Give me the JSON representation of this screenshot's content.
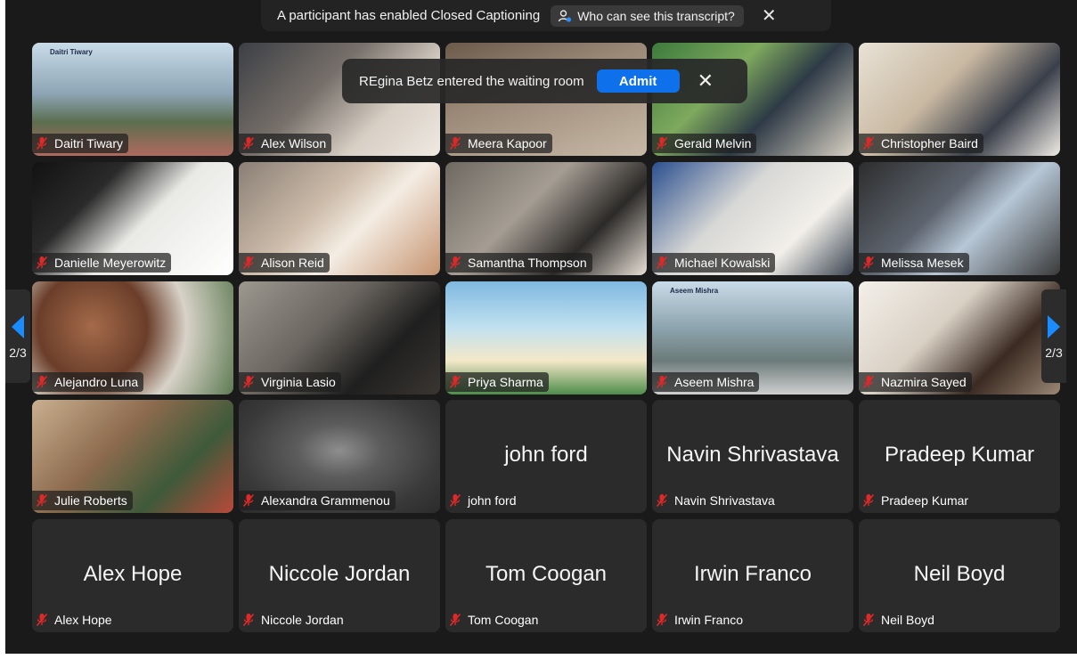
{
  "caption_banner": {
    "text": "A participant has enabled Closed Captioning",
    "transcript_button": "Who can see this transcript?"
  },
  "waiting_room": {
    "text": "REgina Betz entered the waiting room",
    "admit_label": "Admit"
  },
  "pager": {
    "left_page": "2/3",
    "right_page": "2/3"
  },
  "video_labels": {
    "daitri_banner": "Daitri Tiwary",
    "aseem_banner": "Aseem Mishra"
  },
  "participants": [
    {
      "name": "Daitri Tiwary",
      "video": true
    },
    {
      "name": "Alex Wilson",
      "video": true
    },
    {
      "name": "Meera Kapoor",
      "video": true
    },
    {
      "name": "Gerald Melvin",
      "video": true
    },
    {
      "name": "Christopher Baird",
      "video": true
    },
    {
      "name": "Danielle Meyerowitz",
      "video": true
    },
    {
      "name": "Alison Reid",
      "video": true
    },
    {
      "name": "Samantha Thompson",
      "video": true
    },
    {
      "name": "Michael Kowalski",
      "video": true
    },
    {
      "name": "Melissa Mesek",
      "video": true
    },
    {
      "name": "Alejandro Luna",
      "video": true
    },
    {
      "name": "Virginia Lasio",
      "video": true
    },
    {
      "name": "Priya Sharma",
      "video": true
    },
    {
      "name": "Aseem Mishra",
      "video": true
    },
    {
      "name": "Nazmira Sayed",
      "video": true
    },
    {
      "name": "Julie Roberts",
      "video": true
    },
    {
      "name": "Alexandra Grammenou",
      "video": true
    },
    {
      "name": "john ford",
      "video": false
    },
    {
      "name": "Navin Shrivastava",
      "video": false
    },
    {
      "name": "Pradeep Kumar",
      "video": false
    },
    {
      "name": "Alex Hope",
      "video": false
    },
    {
      "name": "Niccole Jordan",
      "video": false
    },
    {
      "name": "Tom Coogan",
      "video": false
    },
    {
      "name": "Irwin Franco",
      "video": false
    },
    {
      "name": "Neil Boyd",
      "video": false
    }
  ],
  "colors": {
    "admit": "#0e71eb",
    "muted_icon": "#e02828",
    "arrow": "#1a8cff"
  },
  "icons": {
    "mic": "muted-mic-icon",
    "transcript": "person-icon",
    "close": "close-icon",
    "prev": "arrow-left-icon",
    "next": "arrow-right-icon"
  }
}
